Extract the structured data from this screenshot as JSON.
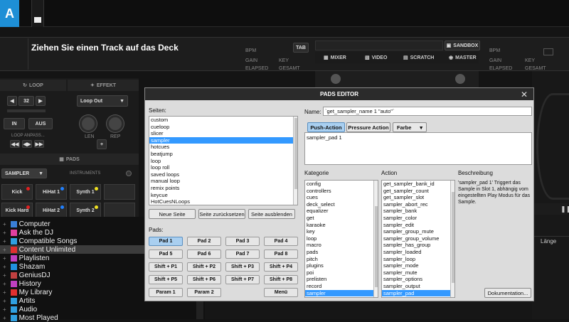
{
  "deck": {
    "letter": "A",
    "track_prompt": "Ziehen Sie einen Track auf das Deck",
    "bpm_label": "BPM",
    "gain_label": "GAIN",
    "key_label": "KEY",
    "elapsed_label": "ELAPSED",
    "gesamt_label": "GESAMT",
    "tab_label": "TAB"
  },
  "right_deck": {
    "bpm_label": "BPM",
    "gain_label": "GAIN",
    "key_label": "KEY",
    "elapsed_label": "ELAPSED",
    "gesamt_label": "GESAMT"
  },
  "center_tabs": {
    "sandbox": "SANDBOX",
    "mixer": "MIXER",
    "video": "VIDEO",
    "scratch": "SCRATCH",
    "master": "MASTER"
  },
  "loop_panel": {
    "loop_header": "LOOP",
    "effekt_header": "EFFEKT",
    "loop_value": "32",
    "in_label": "IN",
    "aus_label": "AUS",
    "loop_anpass": "LOOP ANPASS...",
    "effect_selected": "Loop Out",
    "len_label": "LEN",
    "rep_label": "REP",
    "plus_label": "+",
    "pads_header": "PADS",
    "pads_page": "SAMPLER",
    "instruments_label": "INSTRUMENTS",
    "pads": [
      {
        "label": "Kick",
        "dot": "#e02020"
      },
      {
        "label": "HiHat 1",
        "dot": "#2080ff"
      },
      {
        "label": "Synth 1",
        "dot": "#f0e020"
      },
      {
        "label": "",
        "dot": ""
      },
      {
        "label": "Kick Hard",
        "dot": "#e02020"
      },
      {
        "label": "HiHat 2",
        "dot": "#2080ff"
      },
      {
        "label": "Synth 2",
        "dot": "#f0e020"
      },
      {
        "label": "",
        "dot": ""
      }
    ]
  },
  "browser": {
    "items": [
      {
        "label": "Computer",
        "icon": "computer-icon",
        "color": "#3a7fd8",
        "selected": false
      },
      {
        "label": "Ask the DJ",
        "icon": "ask-dj-icon",
        "color": "#e040a0",
        "selected": false
      },
      {
        "label": "Compatible Songs",
        "icon": "compatible-songs-icon",
        "color": "#30a0e0",
        "selected": false
      },
      {
        "label": "Content Unlimited",
        "icon": "content-unlimited-icon",
        "color": "#e03030",
        "selected": true
      },
      {
        "label": "Playlisten",
        "icon": "playlist-icon",
        "color": "#c040c0",
        "selected": false
      },
      {
        "label": "Shazam",
        "icon": "shazam-icon",
        "color": "#2090e0",
        "selected": false
      },
      {
        "label": "GeniusDJ",
        "icon": "genius-dj-icon",
        "color": "#c04040",
        "selected": false
      },
      {
        "label": "History",
        "icon": "history-icon",
        "color": "#c040c0",
        "selected": false
      },
      {
        "label": "My Library",
        "icon": "library-icon",
        "color": "#e03030",
        "selected": false
      },
      {
        "label": "Artits",
        "icon": "artists-icon",
        "color": "#30a0e0",
        "selected": false
      },
      {
        "label": "Audio",
        "icon": "audio-icon",
        "color": "#30a0e0",
        "selected": false
      },
      {
        "label": "Most Played",
        "icon": "most-played-icon",
        "color": "#30a0e0",
        "selected": false
      }
    ]
  },
  "right_panel": {
    "laenge": "Länge"
  },
  "dialog": {
    "title": "PADS EDITOR",
    "seiten_label": "Seiten:",
    "seiten": [
      "custom",
      "cueloop",
      "slicer",
      "sampler",
      "hotcues",
      "beatjump",
      "loop",
      "loop roll",
      "saved loops",
      "manual loop",
      "remix points",
      "keycue",
      "HotCuesNLoops"
    ],
    "seiten_selected": 3,
    "btn_neue_seite": "Neue Seite",
    "btn_seite_zuruecksetzen": "Seite zurücksetzen",
    "btn_seite_ausblenden": "Seite ausblenden",
    "pads_label": "Pads:",
    "pad_buttons": [
      "Pad 1",
      "Pad 2",
      "Pad 3",
      "Pad 4",
      "Pad 5",
      "Pad 6",
      "Pad 7",
      "Pad 8",
      "Shift + P1",
      "Shift + P2",
      "Shift + P3",
      "Shift + P4",
      "Shift + P5",
      "Shift + P6",
      "Shift + P7",
      "Shift + P8",
      "Param 1",
      "Param 2",
      "Menü"
    ],
    "name_label": "Name:",
    "name_value": "`get_sampler_name 1 \"auto\"`",
    "tab_push": "Push-Action",
    "tab_pressure": "Pressure Action",
    "tab_farbe": "Farbe",
    "action_text": "sampler_pad 1",
    "kategorie_label": "Kategorie",
    "kategorie": [
      "config",
      "controllers",
      "cues",
      "deck_select",
      "equalizer",
      "get",
      "karaoke",
      "key",
      "loop",
      "macro",
      "pads",
      "pitch",
      "plugins",
      "poi",
      "prelisten",
      "record",
      "sampler"
    ],
    "kategorie_selected": 16,
    "action_label": "Action",
    "actions": [
      "get_sampler_bank_id",
      "get_sampler_count",
      "get_sampler_slot",
      "sampler_abort_rec",
      "sampler_bank",
      "sampler_color",
      "sampler_edit",
      "sampler_group_mute",
      "sampler_group_volume",
      "sampler_has_group",
      "sampler_loaded",
      "sampler_loop",
      "sampler_mode",
      "sampler_mute",
      "sampler_options",
      "sampler_output",
      "sampler_pad"
    ],
    "actions_selected": 16,
    "beschreibung_label": "Beschreibung",
    "beschreibung_text": "'sampler_pad 1' Triggert das Sample in Slot 1, abhängig vom eingestellten Play Modus für das Sample.",
    "dokumentation": "Dokumentation..."
  }
}
